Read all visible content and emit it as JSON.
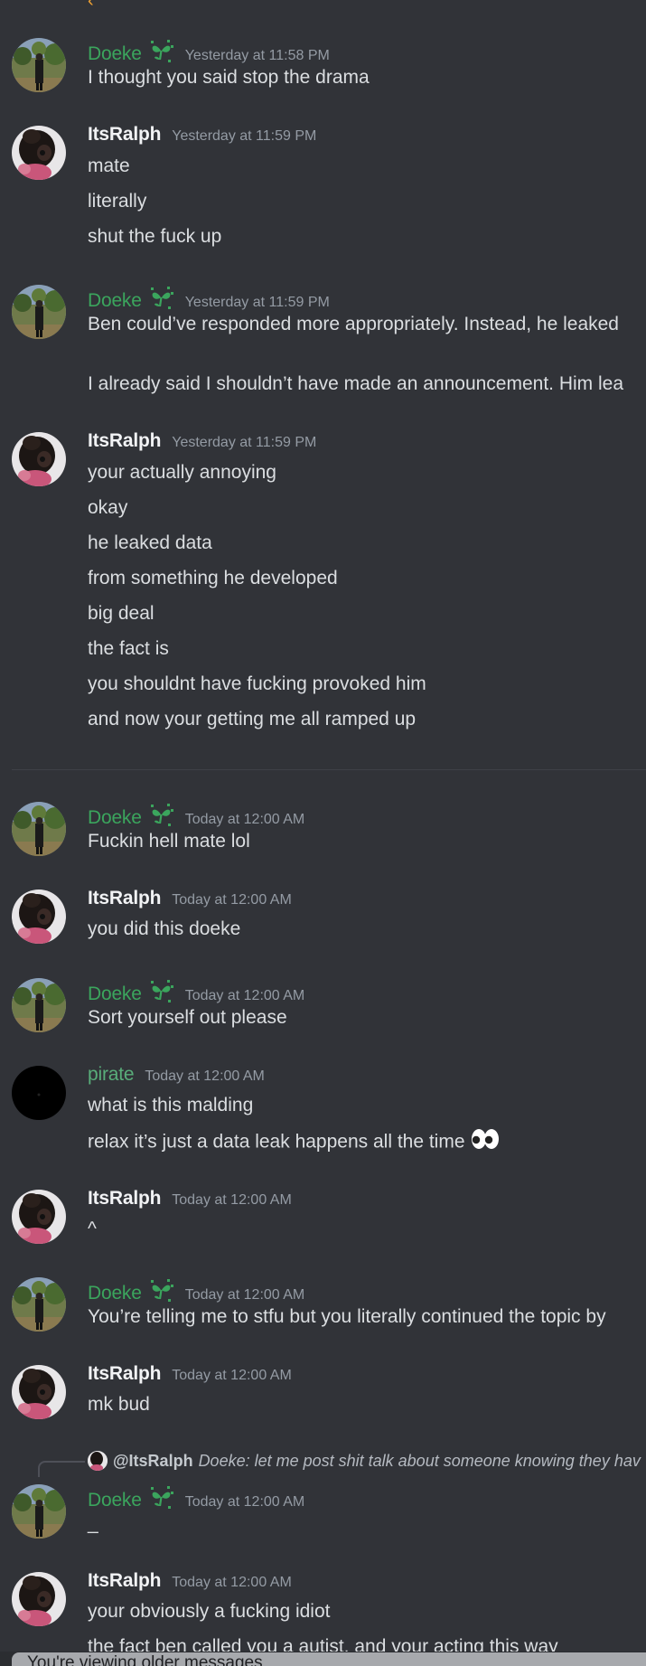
{
  "top_clip": "‹‶",
  "messages": [
    {
      "user": "Doeke",
      "user_type": "doeke",
      "timestamp": "Yesterday at 11:58 PM",
      "lines": [
        "I thought you said stop the drama"
      ]
    },
    {
      "user": "ItsRalph",
      "user_type": "ralph",
      "timestamp": "Yesterday at 11:59 PM",
      "lines": [
        "mate",
        "literally",
        "shut the fuck up"
      ]
    },
    {
      "user": "Doeke",
      "user_type": "doeke",
      "timestamp": "Yesterday at 11:59 PM",
      "lines": [
        "Ben could’ve responded more appropriately. Instead, he leaked",
        "I already said I shouldn’t have made an announcement. Him lea"
      ]
    },
    {
      "user": "ItsRalph",
      "user_type": "ralph",
      "timestamp": "Yesterday at 11:59 PM",
      "lines": [
        "your actually annoying",
        "okay",
        "he leaked data",
        "from something he developed",
        "big deal",
        "the fact is",
        "you shouldnt have fucking provoked him",
        "and now your getting me all ramped up"
      ]
    },
    {
      "user": "Doeke",
      "user_type": "doeke",
      "timestamp": "Today at 12:00 AM",
      "lines": [
        "Fuckin hell mate lol"
      ]
    },
    {
      "user": "ItsRalph",
      "user_type": "ralph",
      "timestamp": "Today at 12:00 AM",
      "lines": [
        "you did this doeke"
      ]
    },
    {
      "user": "Doeke",
      "user_type": "doeke",
      "timestamp": "Today at 12:00 AM",
      "lines": [
        "Sort yourself out please"
      ]
    },
    {
      "user": "pirate",
      "user_type": "pirate",
      "timestamp": "Today at 12:00 AM",
      "lines": [
        "what is this malding",
        "relax it’s just a data leak happens all the time"
      ]
    },
    {
      "user": "ItsRalph",
      "user_type": "ralph",
      "timestamp": "Today at 12:00 AM",
      "lines": [
        "^"
      ]
    },
    {
      "user": "Doeke",
      "user_type": "doeke",
      "timestamp": "Today at 12:00 AM",
      "lines": [
        "You’re telling me to stfu but you literally continued the topic by"
      ]
    },
    {
      "user": "ItsRalph",
      "user_type": "ralph",
      "timestamp": "Today at 12:00 AM",
      "lines": [
        "mk bud"
      ]
    },
    {
      "user": "Doeke",
      "user_type": "doeke",
      "timestamp": "Today at 12:00 AM",
      "lines": [
        "_"
      ],
      "reply": {
        "user": "@ItsRalph",
        "text": "Doeke: let me post shit talk about someone knowing they hav"
      }
    },
    {
      "user": "ItsRalph",
      "user_type": "ralph",
      "timestamp": "Today at 12:00 AM",
      "lines": [
        "your obviously a fucking idiot",
        "the fact ben called you a autist, and your acting this way"
      ]
    }
  ],
  "bottom_notice": "You're viewing older messages",
  "colors": {
    "background": "#313338",
    "doeke_name": "#3ba55d",
    "pirate_name": "#59ad7a",
    "default_name": "#f2f3f5",
    "timestamp": "#949ba4",
    "text": "#dbdee1"
  },
  "icons": {
    "doeke_badge": "sprout-icon",
    "pirate_extra": "eyes-emoji"
  }
}
